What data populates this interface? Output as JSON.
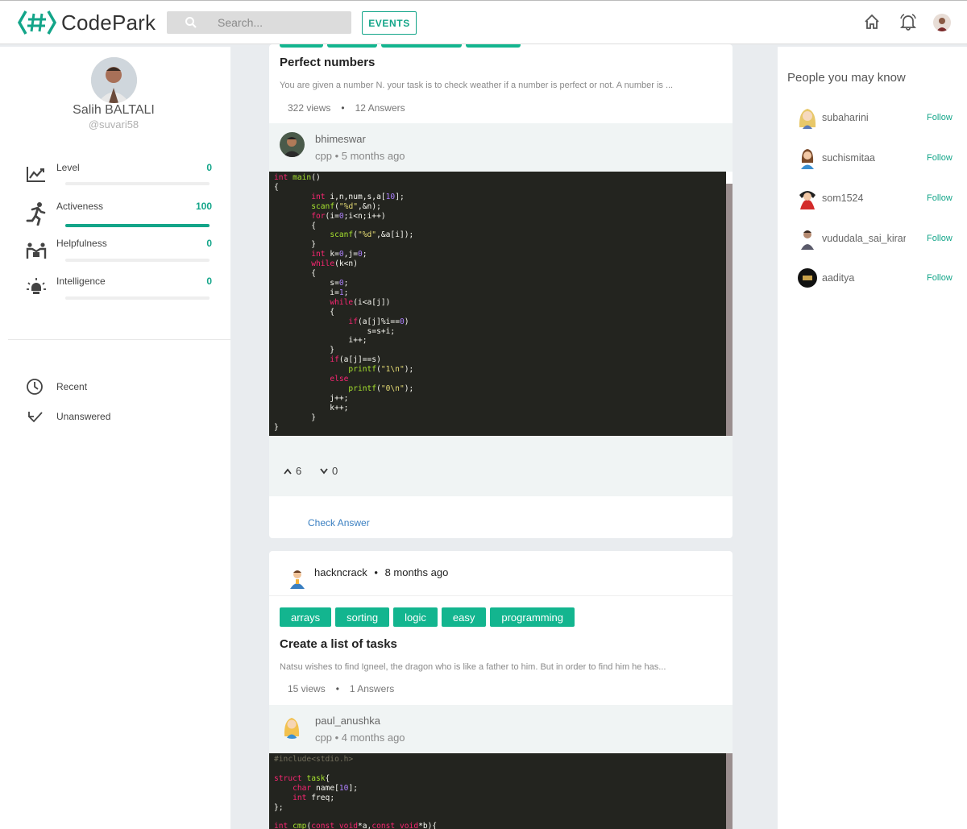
{
  "header": {
    "logo_text": "CodePark",
    "search_placeholder": "Search...",
    "events_label": "EVENTS",
    "icons": [
      "home-icon",
      "bell-icon",
      "user-avatar"
    ]
  },
  "profile": {
    "name": "Salih BALTALI",
    "handle": "@suvari58",
    "stats": [
      {
        "label": "Level",
        "value": "0",
        "progress": 0
      },
      {
        "label": "Activeness",
        "value": "100",
        "progress": 1
      },
      {
        "label": "Helpfulness",
        "value": "0",
        "progress": 0
      },
      {
        "label": "Intelligence",
        "value": "0",
        "progress": 0
      }
    ],
    "nav": [
      {
        "label": "Recent"
      },
      {
        "label": "Unanswered"
      }
    ]
  },
  "feed": {
    "q1": {
      "title": "Perfect numbers",
      "description": "You  are given a number N. your task is to check weather if a number is perfect or not. A number is ...",
      "views": "322 views",
      "answers": "12 Answers",
      "answer": {
        "user": "bhimeswar",
        "lang": "cpp",
        "time": "5 months ago",
        "upvotes": "6",
        "downvotes": "0"
      },
      "check_label": "Check Answer"
    },
    "q2": {
      "author": "hackncrack",
      "time": "8 months ago",
      "tags": [
        "arrays",
        "sorting",
        "logic",
        "easy",
        "programming"
      ],
      "title": "Create a list of tasks",
      "description": "Natsu wishes to find Igneel, the dragon who is like a father to him. But in order to find him he has...",
      "views": "15 views",
      "answers": "1 Answers",
      "answer": {
        "user": "paul_anushka",
        "lang": "cpp",
        "time": "4 months ago"
      }
    }
  },
  "people": {
    "title": "People you may know",
    "follow_label": "Follow",
    "list": [
      {
        "name": "subaharini"
      },
      {
        "name": "suchismitaa"
      },
      {
        "name": "som1524"
      },
      {
        "name": "vududala_sai_kiran"
      },
      {
        "name": "aaditya"
      }
    ]
  },
  "colors": {
    "accent": "#13a589",
    "tag": "#13b58f",
    "link": "#3a7fc1",
    "code_bg": "#23241f"
  }
}
